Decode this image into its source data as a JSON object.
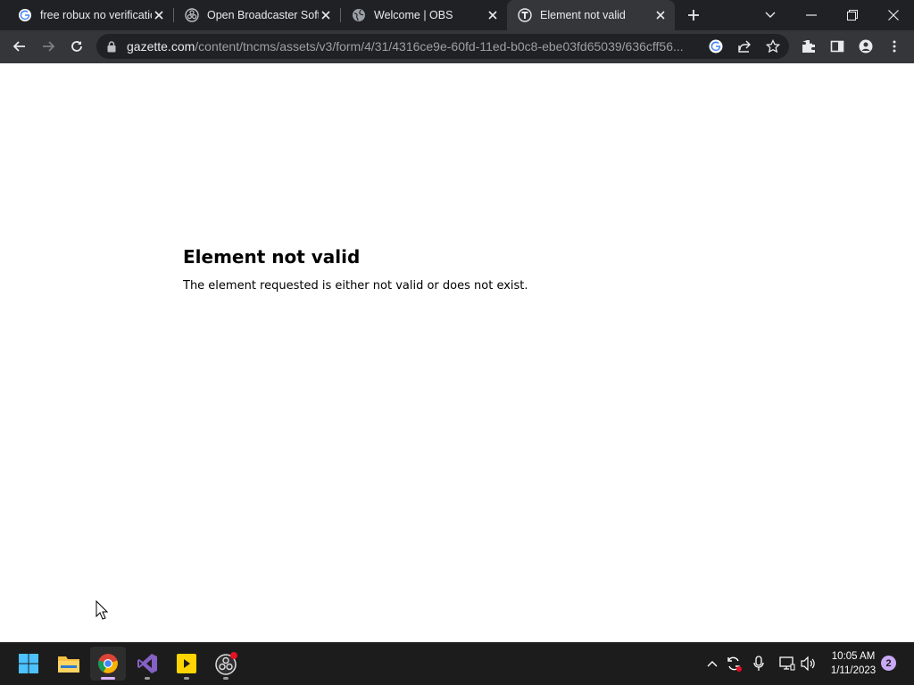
{
  "browser": {
    "tabs": [
      {
        "title": "free robux no verificatio",
        "favicon": "google-icon",
        "active": false
      },
      {
        "title": "Open Broadcaster Softw",
        "favicon": "obs-icon",
        "active": false
      },
      {
        "title": "Welcome | OBS",
        "favicon": "globe-icon",
        "active": false
      },
      {
        "title": "Element not valid",
        "favicon": "site-t-icon",
        "active": true
      }
    ],
    "url_host": "gazette.com",
    "url_path": "/content/tncms/assets/v3/form/4/31/4316ce9e-60fd-11ed-b0c8-ebe03fd65039/636cff56..."
  },
  "page": {
    "heading": "Element not valid",
    "message": "The element requested is either not valid or does not exist."
  },
  "taskbar": {
    "apps": [
      "start-button",
      "file-explorer",
      "chrome",
      "visual-studio",
      "sticky-app",
      "obs"
    ],
    "time": "10:05 AM",
    "date": "1/11/2023",
    "notifications": "2"
  },
  "colors": {
    "tabstrip": "#202124",
    "toolbar": "#35363a",
    "taskbar": "#1c1c1c",
    "accent": "#d8b4fe"
  }
}
